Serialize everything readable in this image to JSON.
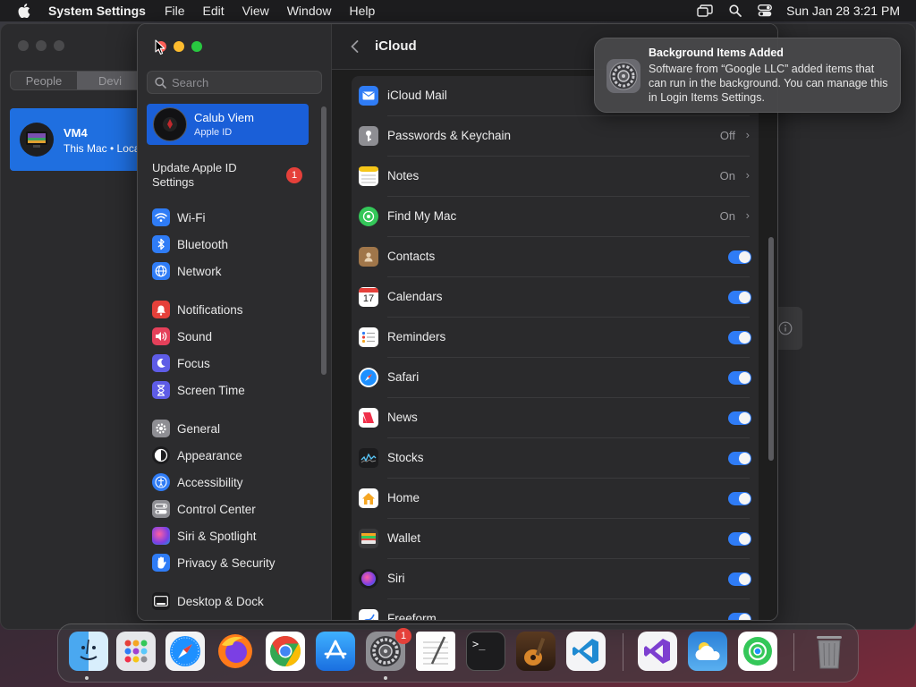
{
  "menubar": {
    "app_name": "System Settings",
    "menus": [
      "File",
      "Edit",
      "View",
      "Window",
      "Help"
    ],
    "clock": "Sun Jan 28  3:21 PM"
  },
  "background_window": {
    "segments": [
      "People",
      "Devi"
    ],
    "device": {
      "name": "VM4",
      "subtitle": "This Mac • Loca"
    }
  },
  "sidebar": {
    "search_placeholder": "Search",
    "account": {
      "name": "Calub Viem",
      "subtitle": "Apple ID"
    },
    "update": {
      "label": "Update Apple ID Settings",
      "badge": "1"
    },
    "items": [
      {
        "label": "Wi-Fi",
        "icon": "wifi-icon",
        "color": "#2f7cf6"
      },
      {
        "label": "Bluetooth",
        "icon": "bluetooth-icon",
        "color": "#2f7cf6"
      },
      {
        "label": "Network",
        "icon": "network-icon",
        "color": "#2f7cf6"
      },
      {
        "label": "Notifications",
        "icon": "bell-icon",
        "color": "#e5403a"
      },
      {
        "label": "Sound",
        "icon": "speaker-icon",
        "color": "#e5405a"
      },
      {
        "label": "Focus",
        "icon": "moon-icon",
        "color": "#5e5ce6"
      },
      {
        "label": "Screen Time",
        "icon": "hourglass-icon",
        "color": "#5e5ce6"
      },
      {
        "label": "General",
        "icon": "gear-icon",
        "color": "#8e8e93"
      },
      {
        "label": "Appearance",
        "icon": "appearance-icon",
        "color": "#1c1c1e"
      },
      {
        "label": "Accessibility",
        "icon": "accessibility-icon",
        "color": "#2f7cf6"
      },
      {
        "label": "Control Center",
        "icon": "control-center-icon",
        "color": "#8e8e93"
      },
      {
        "label": "Siri & Spotlight",
        "icon": "siri-icon",
        "color": "#a040d0"
      },
      {
        "label": "Privacy & Security",
        "icon": "hand-icon",
        "color": "#2f7cf6"
      },
      {
        "label": "Desktop & Dock",
        "icon": "dock-icon",
        "color": "#1c1c1e"
      }
    ]
  },
  "content": {
    "title": "iCloud",
    "rows": [
      {
        "label": "iCloud Mail",
        "icon": "mail-icon",
        "color": "#2f7cf6",
        "kind": "link",
        "value": ""
      },
      {
        "label": "Passwords & Keychain",
        "icon": "key-icon",
        "color": "#8e8e93",
        "kind": "link",
        "value": "Off"
      },
      {
        "label": "Notes",
        "icon": "notes-icon",
        "color": "#f5c518",
        "kind": "link",
        "value": "On"
      },
      {
        "label": "Find My Mac",
        "icon": "findmy-icon",
        "color": "#34c759",
        "kind": "link",
        "value": "On"
      },
      {
        "label": "Contacts",
        "icon": "contacts-icon",
        "color": "#a0764a",
        "kind": "toggle",
        "value": "on"
      },
      {
        "label": "Calendars",
        "icon": "calendar-icon",
        "color": "#ffffff",
        "kind": "toggle",
        "value": "on"
      },
      {
        "label": "Reminders",
        "icon": "reminders-icon",
        "color": "#ffffff",
        "kind": "toggle",
        "value": "on"
      },
      {
        "label": "Safari",
        "icon": "safari-icon",
        "color": "#2f7cf6",
        "kind": "toggle",
        "value": "on"
      },
      {
        "label": "News",
        "icon": "news-icon",
        "color": "#ffffff",
        "kind": "toggle",
        "value": "on"
      },
      {
        "label": "Stocks",
        "icon": "stocks-icon",
        "color": "#1c1c1e",
        "kind": "toggle",
        "value": "on"
      },
      {
        "label": "Home",
        "icon": "home-icon",
        "color": "#ffffff",
        "kind": "toggle",
        "value": "on"
      },
      {
        "label": "Wallet",
        "icon": "wallet-icon",
        "color": "#3a3a3c",
        "kind": "toggle",
        "value": "on"
      },
      {
        "label": "Siri",
        "icon": "siri-icon",
        "color": "#1c1c1e",
        "kind": "toggle",
        "value": "on"
      },
      {
        "label": "Freeform",
        "icon": "freeform-icon",
        "color": "#ffffff",
        "kind": "toggle",
        "value": "on"
      }
    ],
    "calendar_day": "17"
  },
  "notification": {
    "title": "Background Items Added",
    "body": "Software from “Google LLC” added items that can run in the background. You can manage this in Login Items Settings."
  },
  "dock": {
    "apps": [
      {
        "name": "Finder",
        "icon": "finder-icon",
        "running": true
      },
      {
        "name": "Launchpad",
        "icon": "launchpad-icon",
        "running": false
      },
      {
        "name": "Safari",
        "icon": "safari-icon",
        "running": false
      },
      {
        "name": "Firefox",
        "icon": "firefox-icon",
        "running": false
      },
      {
        "name": "Chrome",
        "icon": "chrome-icon",
        "running": false
      },
      {
        "name": "App Store",
        "icon": "app-store-icon",
        "running": false
      },
      {
        "name": "System Settings",
        "icon": "system-settings-icon",
        "running": true,
        "badge": "1"
      },
      {
        "name": "TextEdit",
        "icon": "textedit-icon",
        "running": false
      },
      {
        "name": "Terminal",
        "icon": "terminal-icon",
        "running": false
      },
      {
        "name": "GarageBand",
        "icon": "garageband-icon",
        "running": false
      },
      {
        "name": "VS Code",
        "icon": "vscode-icon",
        "running": false
      },
      {
        "name": "Visual Studio",
        "icon": "visual-studio-icon",
        "running": false
      },
      {
        "name": "Weather",
        "icon": "weather-icon",
        "running": false
      },
      {
        "name": "Find My",
        "icon": "findmy-icon",
        "running": false
      },
      {
        "name": "Trash",
        "icon": "trash-icon",
        "running": false
      }
    ],
    "terminal_glyph": ">_"
  }
}
